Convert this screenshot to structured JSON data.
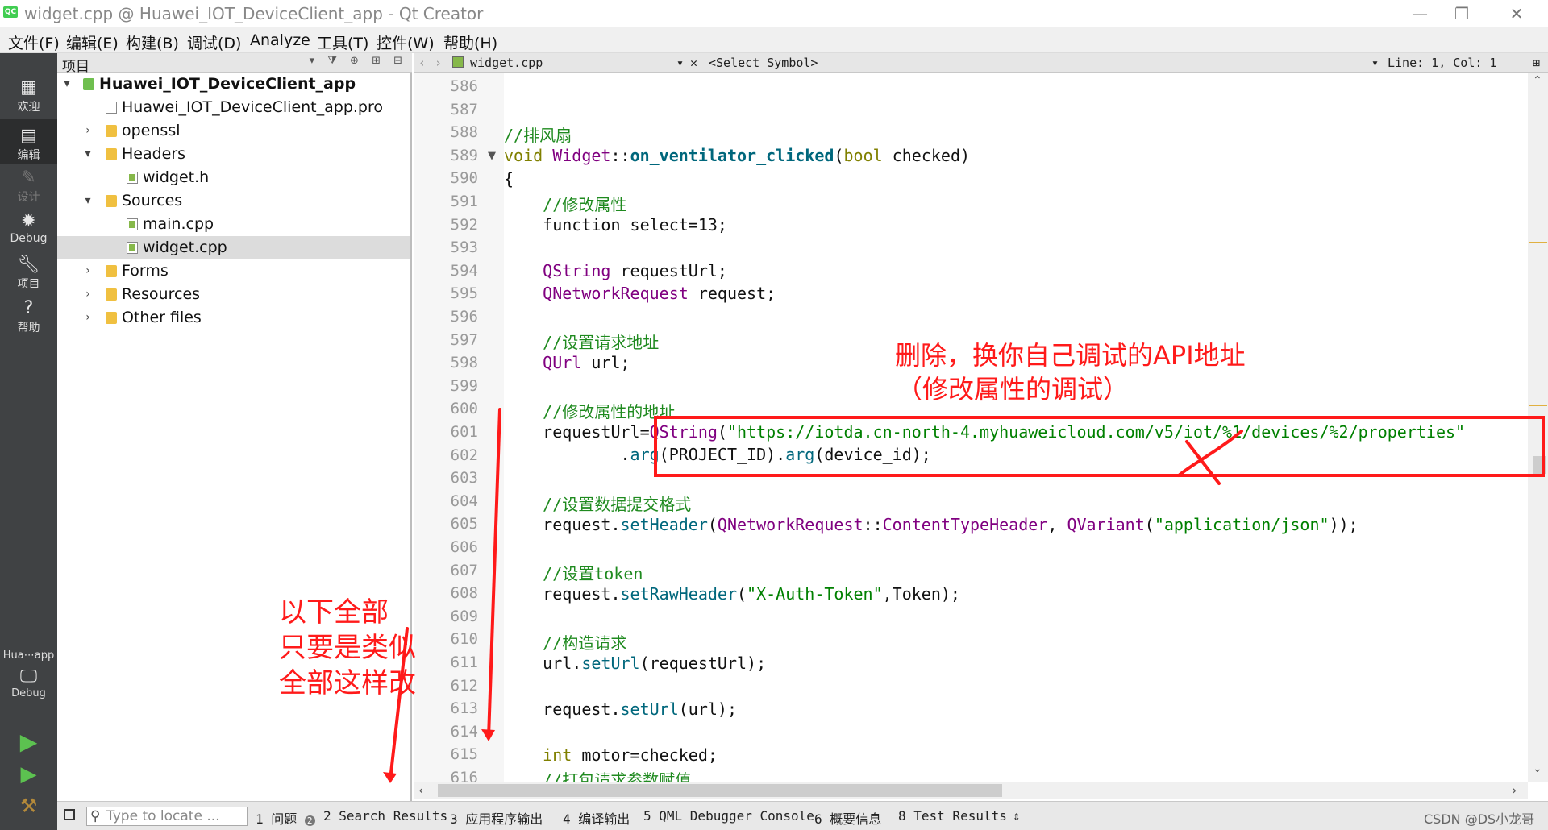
{
  "window": {
    "title": "widget.cpp @ Huawei_IOT_DeviceClient_app - Qt Creator",
    "app_icon_text": "QC",
    "controls": [
      "—",
      "❐",
      "✕"
    ]
  },
  "menu": [
    "文件(F)",
    "编辑(E)",
    "构建(B)",
    "调试(D)",
    "Analyze",
    "工具(T)",
    "控件(W)",
    "帮助(H)"
  ],
  "modes": [
    {
      "label": "欢迎",
      "icon": "grid-icon"
    },
    {
      "label": "编辑",
      "icon": "edit-icon"
    },
    {
      "label": "设计",
      "icon": "pen-icon"
    },
    {
      "label": "Debug",
      "icon": "bug-icon"
    },
    {
      "label": "项目",
      "icon": "wrench-icon"
    },
    {
      "label": "帮助",
      "icon": "help-icon"
    }
  ],
  "kit": {
    "name": "Hua⋯app",
    "mode": "Debug"
  },
  "project_panel": {
    "header": "项目",
    "tree": [
      {
        "label": "Huawei_IOT_DeviceClient_app",
        "depth": 0,
        "expanded": true,
        "icon": "proj",
        "bold": true
      },
      {
        "label": "Huawei_IOT_DeviceClient_app.pro",
        "depth": 1,
        "icon": "file"
      },
      {
        "label": "openssl",
        "depth": 1,
        "expanded": false,
        "icon": "folder"
      },
      {
        "label": "Headers",
        "depth": 1,
        "expanded": true,
        "icon": "folder"
      },
      {
        "label": "widget.h",
        "depth": 2,
        "icon": "cfile"
      },
      {
        "label": "Sources",
        "depth": 1,
        "expanded": true,
        "icon": "folder"
      },
      {
        "label": "main.cpp",
        "depth": 2,
        "icon": "cfile"
      },
      {
        "label": "widget.cpp",
        "depth": 2,
        "icon": "cfile",
        "selected": true
      },
      {
        "label": "Forms",
        "depth": 1,
        "expanded": false,
        "icon": "folder"
      },
      {
        "label": "Resources",
        "depth": 1,
        "expanded": false,
        "icon": "folder"
      },
      {
        "label": "Other files",
        "depth": 1,
        "expanded": false,
        "icon": "folder"
      }
    ]
  },
  "editor": {
    "file": "widget.cpp",
    "symbol": "<Select Symbol>",
    "position": "Line: 1, Col: 1",
    "line_numbers": [
      "586",
      "587",
      "588",
      "589",
      "590",
      "591",
      "592",
      "593",
      "594",
      "595",
      "596",
      "597",
      "598",
      "599",
      "600",
      "601",
      "602",
      "603",
      "604",
      "605",
      "606",
      "607",
      "608",
      "609",
      "610",
      "611",
      "612",
      "613",
      "614",
      "615",
      "616"
    ]
  },
  "code_lines": {
    "l586": "",
    "l587": "",
    "l588": "//排风扇",
    "l589_void": "void ",
    "l589_cls": "Widget",
    "l589_sep": "::",
    "l589_fn": "on_ventilator_clicked",
    "l589_open": "(",
    "l589_bool": "bool",
    "l589_arg": " checked)",
    "l590": "{",
    "l591": "    //修改属性",
    "l592": "    function_select=13;",
    "l594_ty": "    QString",
    "l594_rest": " requestUrl;",
    "l595_ty": "    QNetworkRequest",
    "l595_rest": " request;",
    "l597": "    //设置请求地址",
    "l598_ty": "    QUrl",
    "l598_rest": " url;",
    "l600": "    //修改属性的地址",
    "l601_a": "    requestUrl=",
    "l601_ty": "QString",
    "l601_b": "(",
    "l601_str": "\"https://iotda.cn-north-4.myhuaweicloud.com/v5/iot/%1/devices/%2/properties\"",
    "l602_a": "            .",
    "l602_fn": "arg",
    "l602_b": "(PROJECT_ID).",
    "l602_fn2": "arg",
    "l602_c": "(device_id);",
    "l604": "    //设置数据提交格式",
    "l605_a": "    request.",
    "l605_fn": "setHeader",
    "l605_b": "(",
    "l605_ty": "QNetworkRequest",
    "l605_c": "::",
    "l605_ty2": "ContentTypeHeader",
    "l605_d": ", ",
    "l605_ty3": "QVariant",
    "l605_e": "(",
    "l605_str": "\"application/json\"",
    "l605_f": "));",
    "l607": "    //设置token",
    "l608_a": "    request.",
    "l608_fn": "setRawHeader",
    "l608_b": "(",
    "l608_str": "\"X-Auth-Token\"",
    "l608_c": ",Token);",
    "l610": "    //构造请求",
    "l611_a": "    url.",
    "l611_fn": "setUrl",
    "l611_b": "(requestUrl);",
    "l613_a": "    request.",
    "l613_fn": "setUrl",
    "l613_b": "(url);",
    "l615_kw": "    int",
    "l615_b": " motor=checked;",
    "l616": "    //打包请求参数赋值"
  },
  "status_bar": {
    "locate_placeholder": "Type to locate ...",
    "panes": [
      "1 问题",
      "2 Search Results",
      "3 应用程序输出",
      "4 编译输出",
      "5 QML Debugger Console",
      "6 概要信息",
      "8 Test Results"
    ],
    "problems_badge": "2"
  },
  "annotations": {
    "delete_note_1": "删除，换你自己调试的API地址",
    "delete_note_2": "（修改属性的调试）",
    "left_note_1": "以下全部",
    "left_note_2": "只要是类似",
    "left_note_3": "全部这样改",
    "color": "#ff1a1a"
  },
  "watermark": "CSDN @DS小龙哥"
}
